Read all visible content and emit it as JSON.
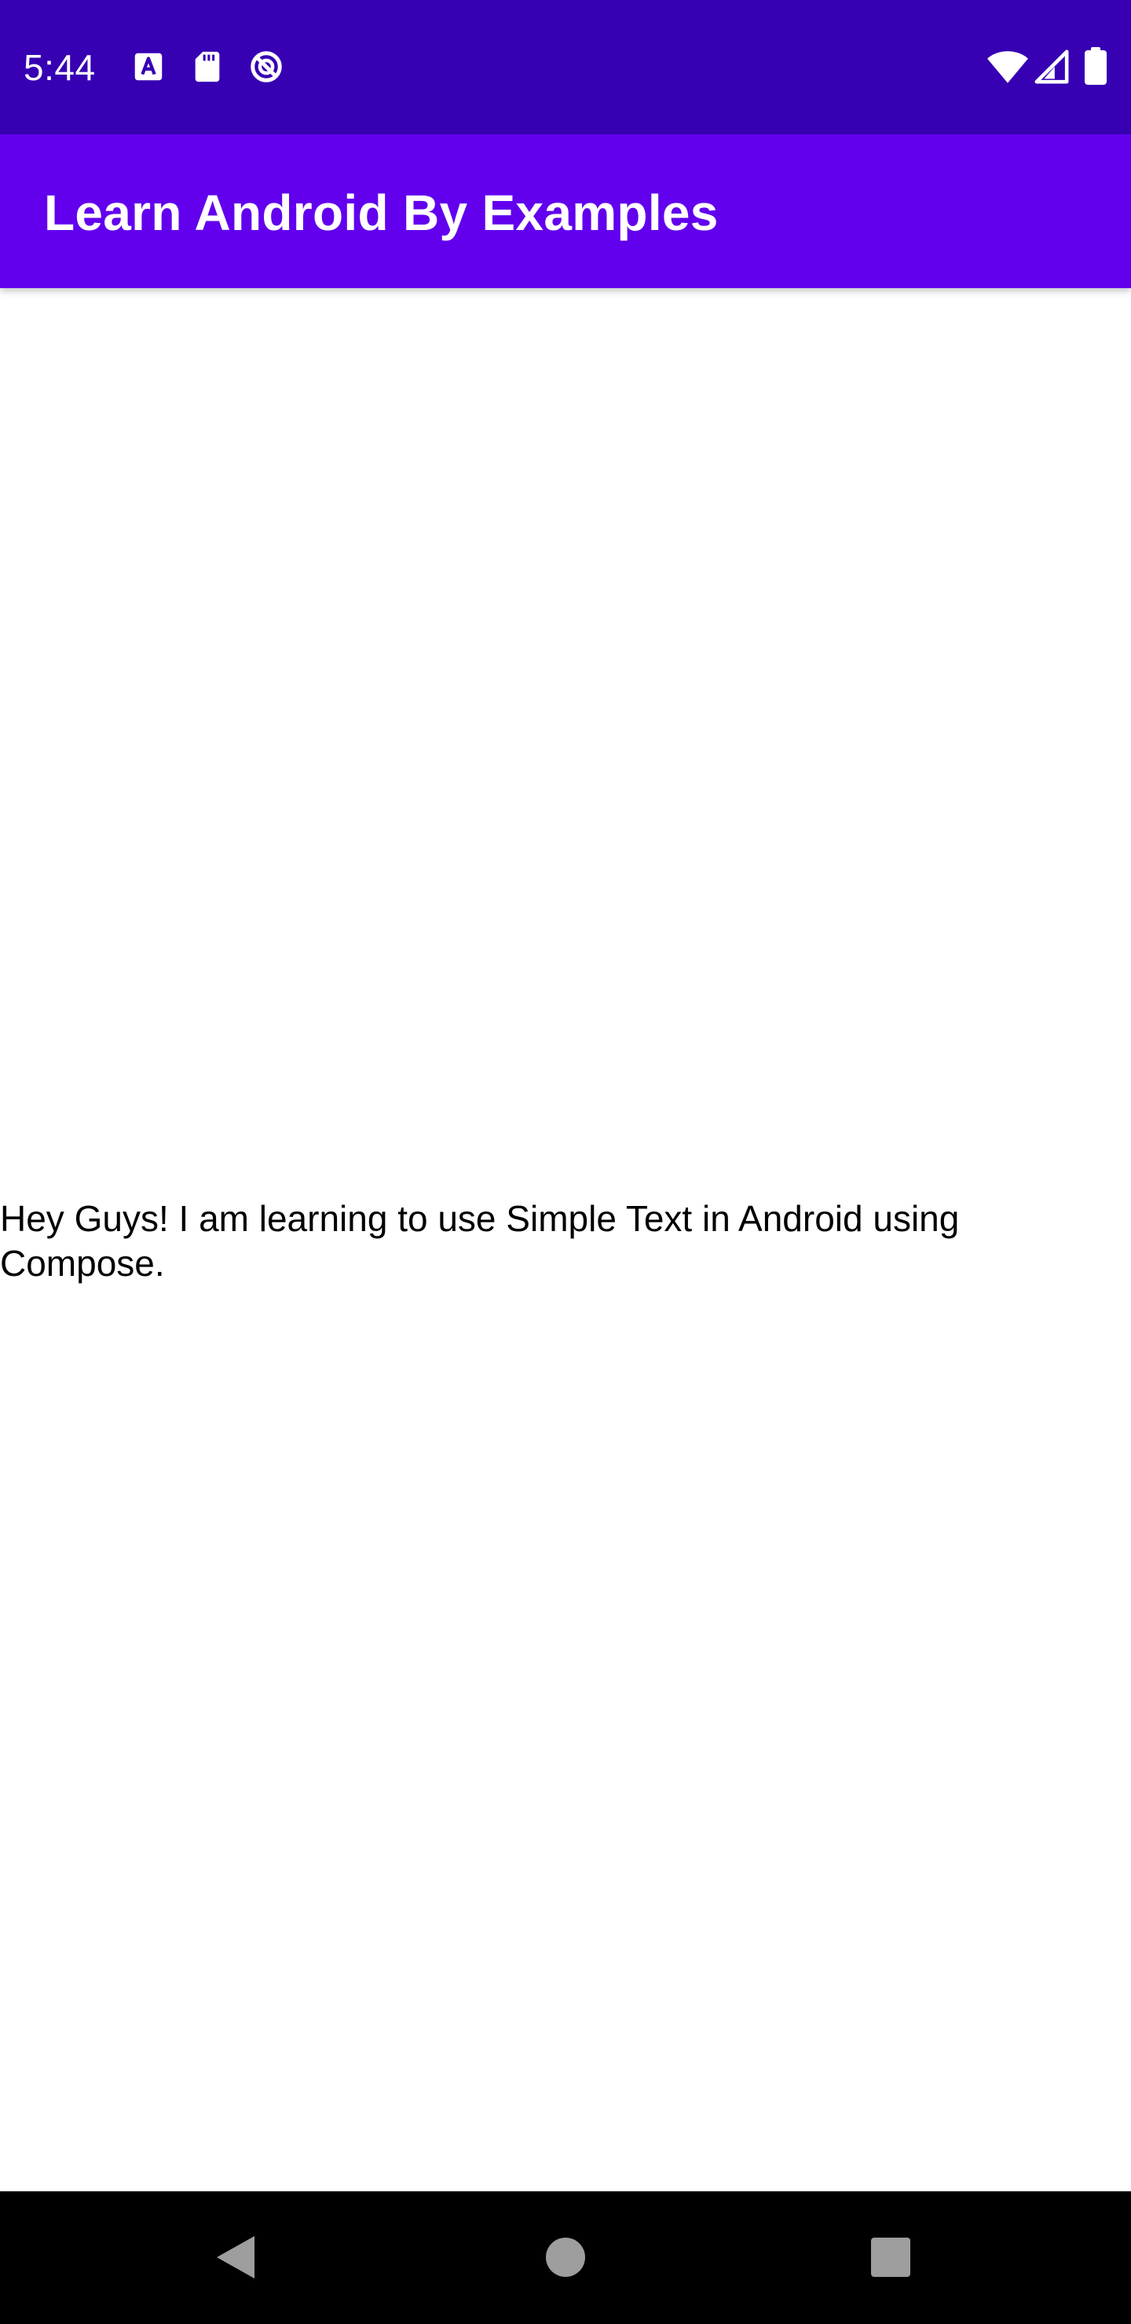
{
  "colors": {
    "status_bar": "#3700B3",
    "app_bar": "#6200EE",
    "nav_bar": "#000000",
    "nav_icon": "#9E9E9E"
  },
  "status_bar": {
    "time": "5:44",
    "left_icons": [
      "text-a-icon",
      "sd-card-icon",
      "data-saver-icon"
    ],
    "right_icons": [
      "wifi-icon",
      "cell-signal-icon",
      "battery-icon"
    ]
  },
  "app_bar": {
    "title": "Learn Android By Examples"
  },
  "main": {
    "text": "Hey Guys! I am learning to use Simple Text in Android using Compose."
  },
  "nav_bar": {
    "buttons": [
      "back-icon",
      "home-icon",
      "recents-icon"
    ]
  }
}
